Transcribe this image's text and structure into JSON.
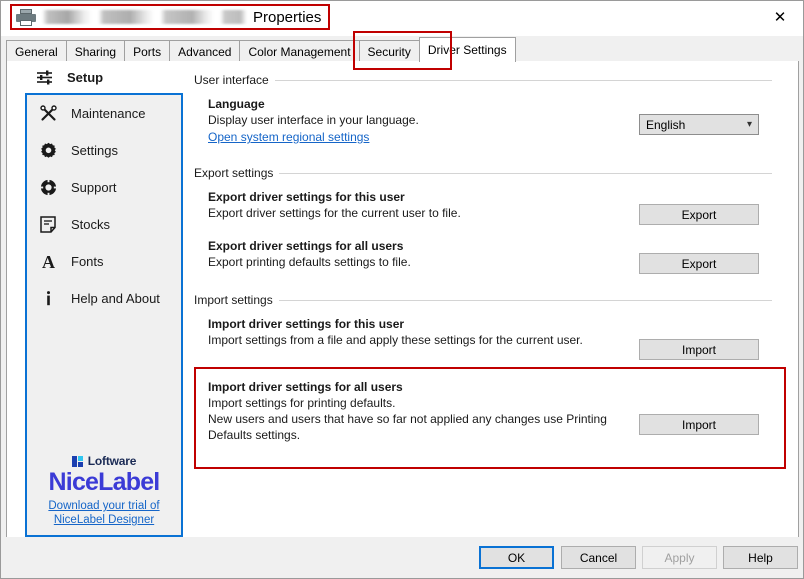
{
  "window": {
    "title_suffix": "Properties",
    "printer_name_redacted": true,
    "close_icon": "close-icon",
    "printer_icon": "printer-icon"
  },
  "tabs": [
    {
      "label": "General",
      "active": false
    },
    {
      "label": "Sharing",
      "active": false
    },
    {
      "label": "Ports",
      "active": false
    },
    {
      "label": "Advanced",
      "active": false
    },
    {
      "label": "Color Management",
      "active": false
    },
    {
      "label": "Security",
      "active": false
    },
    {
      "label": "Driver Settings",
      "active": true
    }
  ],
  "sidebar": {
    "header": {
      "label": "Setup",
      "icon": "sliders-icon"
    },
    "items": [
      {
        "label": "Maintenance",
        "icon": "tools-icon"
      },
      {
        "label": "Settings",
        "icon": "gear-icon"
      },
      {
        "label": "Support",
        "icon": "lifebuoy-icon"
      },
      {
        "label": "Stocks",
        "icon": "page-icon"
      },
      {
        "label": "Fonts",
        "icon": "letter-a-icon"
      },
      {
        "label": "Help and About",
        "icon": "info-icon"
      }
    ],
    "branding": {
      "loftware": "Loftware",
      "nicelabel": "NiceLabel",
      "trial_line1": "Download your trial of",
      "trial_line2": "NiceLabel Designer"
    }
  },
  "main": {
    "user_interface": {
      "section": "User interface",
      "language_title": "Language",
      "language_desc": "Display user interface in your language.",
      "regional_link": "Open system regional settings",
      "language_value": "English"
    },
    "export_settings": {
      "section": "Export settings",
      "this_user_title": "Export driver settings for this user",
      "this_user_desc": "Export driver settings for the current user to file.",
      "this_user_button": "Export",
      "all_users_title": "Export driver settings for all users",
      "all_users_desc": "Export printing defaults settings to file.",
      "all_users_button": "Export"
    },
    "import_settings": {
      "section": "Import settings",
      "this_user_title": "Import driver settings for this user",
      "this_user_desc": "Import settings from a file and apply these settings for the current user.",
      "this_user_button": "Import",
      "all_users_title": "Import driver settings for all users",
      "all_users_desc_line1": "Import settings for printing defaults.",
      "all_users_desc_line2": "New users and users that have so far not applied any changes use Printing",
      "all_users_desc_line3": "Defaults settings.",
      "all_users_button": "Import"
    }
  },
  "footer": {
    "ok": "OK",
    "cancel": "Cancel",
    "apply": "Apply",
    "help": "Help"
  },
  "colors": {
    "highlight_red": "#c00000",
    "accent_blue": "#0a72d4",
    "link_blue": "#1565c8",
    "nicelabel_purple": "#3b3bd6"
  }
}
